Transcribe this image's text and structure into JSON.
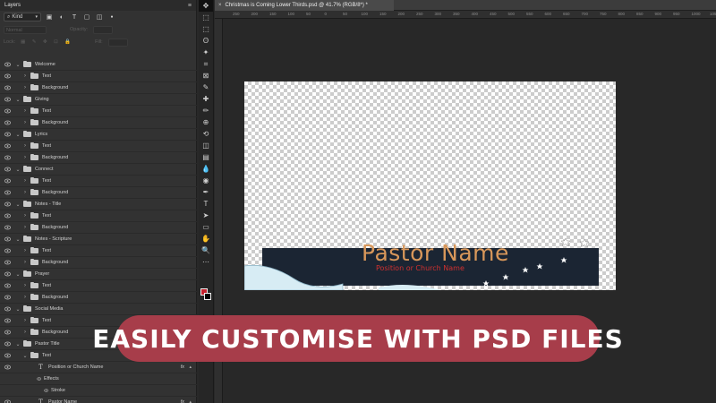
{
  "layers_panel": {
    "title": "Layers",
    "kind_label": "Kind",
    "dim_fields": [
      "Normal",
      "Opacity:",
      "Lock:",
      "Fill:"
    ],
    "layers": [
      {
        "type": "group",
        "label": "Welcome",
        "depth": 0,
        "open": true
      },
      {
        "type": "group",
        "label": "Text",
        "depth": 1,
        "open": false
      },
      {
        "type": "group",
        "label": "Background",
        "depth": 1,
        "open": false
      },
      {
        "type": "group",
        "label": "Giving",
        "depth": 0,
        "open": true
      },
      {
        "type": "group",
        "label": "Text",
        "depth": 1,
        "open": false
      },
      {
        "type": "group",
        "label": "Background",
        "depth": 1,
        "open": false
      },
      {
        "type": "group",
        "label": "Lyrics",
        "depth": 0,
        "open": true
      },
      {
        "type": "group",
        "label": "Text",
        "depth": 1,
        "open": false
      },
      {
        "type": "group",
        "label": "Background",
        "depth": 1,
        "open": false
      },
      {
        "type": "group",
        "label": "Connect",
        "depth": 0,
        "open": true
      },
      {
        "type": "group",
        "label": "Text",
        "depth": 1,
        "open": false
      },
      {
        "type": "group",
        "label": "Background",
        "depth": 1,
        "open": false
      },
      {
        "type": "group",
        "label": "Notes - Title",
        "depth": 0,
        "open": true
      },
      {
        "type": "group",
        "label": "Text",
        "depth": 1,
        "open": false
      },
      {
        "type": "group",
        "label": "Background",
        "depth": 1,
        "open": false
      },
      {
        "type": "group",
        "label": "Notes - Scripture",
        "depth": 0,
        "open": true
      },
      {
        "type": "group",
        "label": "Text",
        "depth": 1,
        "open": false
      },
      {
        "type": "group",
        "label": "Background",
        "depth": 1,
        "open": false
      },
      {
        "type": "group",
        "label": "Prayer",
        "depth": 0,
        "open": true
      },
      {
        "type": "group",
        "label": "Text",
        "depth": 1,
        "open": false
      },
      {
        "type": "group",
        "label": "Background",
        "depth": 1,
        "open": false
      },
      {
        "type": "group",
        "label": "Social Media",
        "depth": 0,
        "open": true
      },
      {
        "type": "group",
        "label": "Text",
        "depth": 1,
        "open": false
      },
      {
        "type": "group",
        "label": "Background",
        "depth": 1,
        "open": false
      },
      {
        "type": "group",
        "label": "Pastor Title",
        "depth": 0,
        "open": true
      },
      {
        "type": "group",
        "label": "Text",
        "depth": 1,
        "open": true
      },
      {
        "type": "text",
        "label": "Position or Church Name",
        "depth": 2,
        "fx": "fx"
      },
      {
        "type": "effect",
        "label": "Effects",
        "depth": 3
      },
      {
        "type": "effect",
        "label": "Stroke",
        "depth": 4
      },
      {
        "type": "text",
        "label": "Pastor Name",
        "depth": 2,
        "fx": "fx"
      }
    ]
  },
  "document_tab": {
    "close": "×",
    "title": "Christmas is Coming Lower Thirds.psd @ 41.7% (RGB/8*) *"
  },
  "ruler": {
    "ticks": [
      "250",
      "200",
      "150",
      "100",
      "50",
      "0",
      "50",
      "100",
      "150",
      "200",
      "250",
      "300",
      "350",
      "400",
      "450",
      "500",
      "550",
      "600",
      "650",
      "700",
      "750",
      "800",
      "850",
      "900",
      "950",
      "1000",
      "1050"
    ]
  },
  "canvas": {
    "pastor_name": "Pastor Name",
    "position_text": "Position or Church Name",
    "colors": {
      "bar": "#1b2533",
      "name": "#d8975a",
      "position": "#d0302f"
    }
  },
  "banner": {
    "text": "EASILY CUSTOMISE WITH PSD FILES",
    "color": "#a73d4a"
  },
  "toolbar": {
    "tools": [
      "move-tool",
      "artboard-tool",
      "marquee-tool",
      "lasso-tool",
      "magic-wand-tool",
      "crop-tool",
      "frame-tool",
      "eyedropper-tool",
      "healing-tool",
      "brush-tool",
      "clone-stamp-tool",
      "history-brush-tool",
      "eraser-tool",
      "gradient-tool",
      "blur-tool",
      "dodge-tool",
      "pen-tool",
      "type-tool",
      "path-selection-tool",
      "rectangle-tool",
      "hand-tool",
      "zoom-tool",
      "more-tools"
    ],
    "foreground_color": "#c3202c",
    "background_color": "#000000"
  }
}
